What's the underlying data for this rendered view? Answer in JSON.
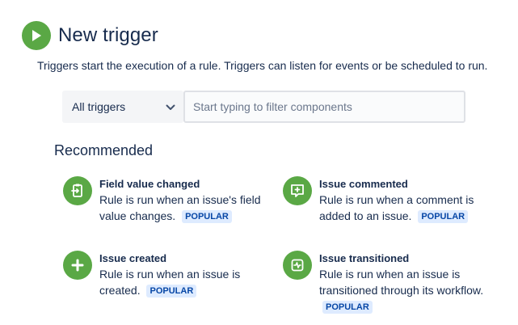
{
  "header": {
    "title": "New trigger",
    "icon": "play-icon",
    "subtitle": "Triggers start the execution of a rule. Triggers can listen for events or be scheduled to run."
  },
  "filter": {
    "select_value": "All triggers",
    "search_placeholder": "Start typing to filter components"
  },
  "section_title": "Recommended",
  "triggers": [
    {
      "title": "Field value changed",
      "desc": "Rule is run when an issue's field value changes.",
      "badge": "POPULAR",
      "icon": "field-change-icon"
    },
    {
      "title": "Issue commented",
      "desc": "Rule is run when a comment is added to an issue.",
      "badge": "POPULAR",
      "icon": "comment-icon"
    },
    {
      "title": "Issue created",
      "desc": "Rule is run when an issue is created.",
      "badge": "POPULAR",
      "icon": "plus-icon"
    },
    {
      "title": "Issue transitioned",
      "desc": "Rule is run when an issue is transitioned through its workflow.",
      "badge": "POPULAR",
      "icon": "transition-icon"
    }
  ],
  "colors": {
    "accent_green": "#5aa845",
    "badge_bg": "#deebff",
    "badge_text": "#0747a6"
  }
}
